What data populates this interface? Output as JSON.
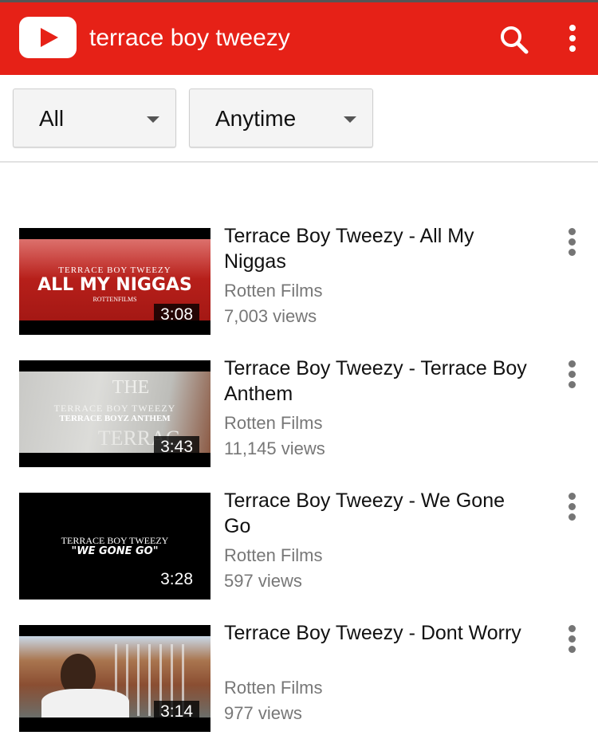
{
  "header": {
    "logo": "youtube-logo",
    "query": "terrace boy tweezy",
    "search_icon": "search-icon",
    "menu_icon": "more-vert-icon",
    "brand_color": "#e62117"
  },
  "filters": [
    {
      "label": "All",
      "icon": "dropdown-arrow-icon"
    },
    {
      "label": "Anytime",
      "icon": "dropdown-arrow-icon"
    }
  ],
  "results": [
    {
      "title": "Terrace Boy Tweezy - All My Niggas",
      "channel": "Rotten Films",
      "views": "7,003 views",
      "duration": "3:08",
      "thumb_text": [
        "TERRACE BOY TWEEZY",
        "ALL MY NIGGAS",
        "ROTTENFILMS"
      ]
    },
    {
      "title": "Terrace Boy Tweezy - Terrace Boy Anthem",
      "channel": "Rotten Films",
      "views": "11,145 views",
      "duration": "3:43",
      "thumb_text": [
        "THE",
        "TERRACE BOY TWEEZY",
        "TERRACE BOYZ ANTHEM",
        "TERRAC"
      ]
    },
    {
      "title": "Terrace Boy Tweezy - We Gone Go",
      "channel": "Rotten Films",
      "views": "597 views",
      "duration": "3:28",
      "thumb_text": [
        "TERRACE BOY TWEEZY",
        "\"WE GONE GO\""
      ]
    },
    {
      "title": "Terrace Boy Tweezy - Dont Worry",
      "channel": "Rotten Films",
      "views": "977 views",
      "duration": "3:14",
      "thumb_text": []
    }
  ]
}
